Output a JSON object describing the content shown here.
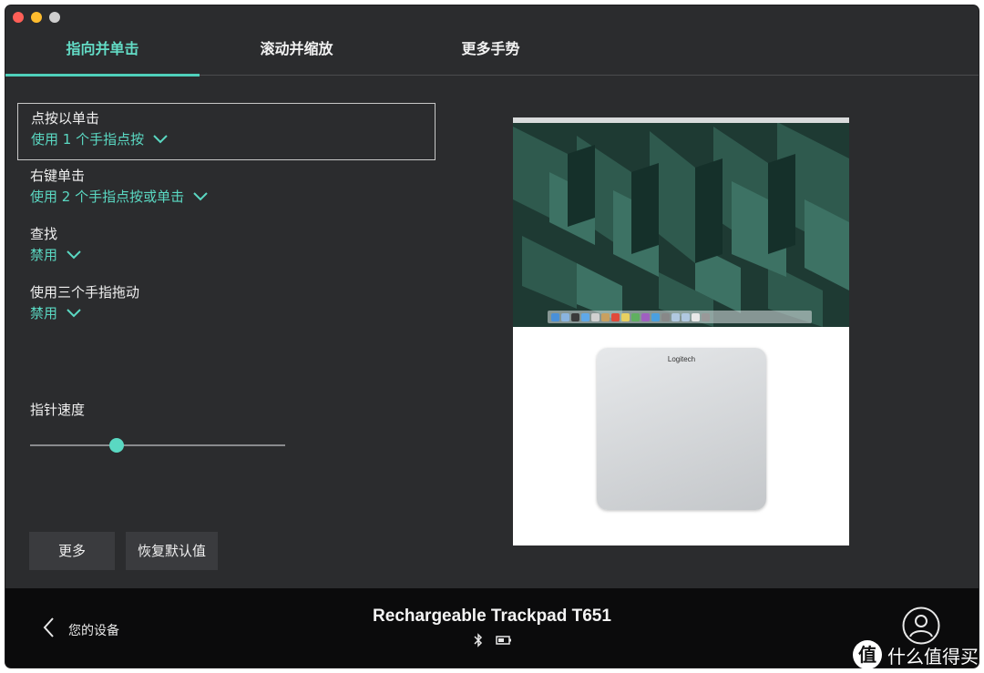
{
  "tabs": [
    {
      "label": "指向并单击",
      "active": true
    },
    {
      "label": "滚动并缩放",
      "active": false
    },
    {
      "label": "更多手势",
      "active": false
    }
  ],
  "settings": [
    {
      "label": "点按以单击",
      "value": "使用 1 个手指点按"
    },
    {
      "label": "右键单击",
      "value": "使用 2 个手指点按或单击"
    },
    {
      "label": "查找",
      "value": "禁用"
    },
    {
      "label": "使用三个手指拖动",
      "value": "禁用"
    }
  ],
  "pointer_speed": {
    "label": "指针速度",
    "value_fraction": 0.34
  },
  "buttons": {
    "more": "更多",
    "restore": "恢复默认值"
  },
  "preview": {
    "logo_text": "Logitech"
  },
  "footer": {
    "back_label": "您的设备",
    "device_name": "Rechargeable Trackpad T651",
    "status_icons": [
      "bluetooth-icon",
      "battery-icon"
    ]
  },
  "watermark": {
    "badge": "值",
    "text": "什么值得买"
  },
  "colors": {
    "accent": "#5ad8c2",
    "background": "#2b2c2e",
    "footer": "#0b0b0c"
  }
}
